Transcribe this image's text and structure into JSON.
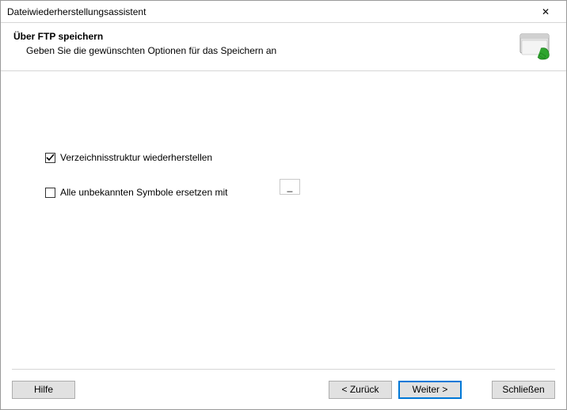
{
  "window": {
    "title": "Dateiwiederherstellungsassistent"
  },
  "header": {
    "heading": "Über FTP speichern",
    "subheading": "Geben Sie die gewünschten Optionen für das Speichern an"
  },
  "options": {
    "restore_structure": {
      "label": "Verzeichnisstruktur wiederherstellen",
      "checked": true
    },
    "replace_symbols": {
      "label": "Alle unbekannten Symbole ersetzen mit",
      "checked": false,
      "value": "_"
    }
  },
  "buttons": {
    "help": "Hilfe",
    "back": "< Zurück",
    "next": "Weiter >",
    "close": "Schließen"
  },
  "icons": {
    "close_glyph": "✕"
  }
}
